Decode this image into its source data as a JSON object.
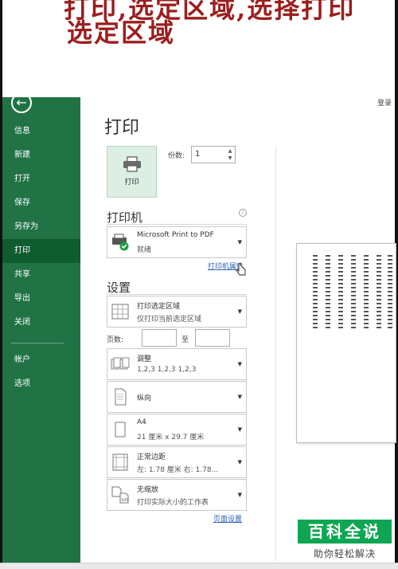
{
  "caption": {
    "line1": "打印,选定区域,选择打印",
    "line2": "选定区域"
  },
  "header": {
    "login": "登录"
  },
  "sidebar": {
    "back": "←",
    "items": [
      {
        "label": "信息"
      },
      {
        "label": "新建"
      },
      {
        "label": "打开"
      },
      {
        "label": "保存"
      },
      {
        "label": "另存为"
      },
      {
        "label": "打印",
        "active": true
      },
      {
        "label": "共享"
      },
      {
        "label": "导出"
      },
      {
        "label": "关闭"
      },
      {
        "label": "帐户"
      },
      {
        "label": "选项"
      }
    ]
  },
  "main": {
    "title": "打印",
    "print_button": "打印",
    "copies_label": "份数:",
    "copies_value": "1",
    "printer_heading": "打印机",
    "printer": {
      "name": "Microsoft Print to PDF",
      "status": "就绪"
    },
    "printer_properties": "打印机属性",
    "settings_heading": "设置",
    "settings": [
      {
        "name": "print-range",
        "t1": "打印选定区域",
        "t2": "仅打印当前选定区域",
        "icon": "sheet-grid-icon"
      },
      {
        "name": "collation",
        "t1": "调整",
        "t2": "1,2,3    1,2,3    1,2,3",
        "icon": "collate-icon"
      },
      {
        "name": "orientation",
        "t1": "纵向",
        "t2": "",
        "icon": "portrait-page-icon"
      },
      {
        "name": "paper-size",
        "t1": "A4",
        "t2": "21 厘米 x 29.7 厘米",
        "icon": "paper-icon"
      },
      {
        "name": "margins",
        "t1": "正常边距",
        "t2": "左: 1.78 厘米    右: 1.78...",
        "icon": "margins-icon"
      },
      {
        "name": "scaling",
        "t1": "无缩放",
        "t2": "打印实际大小的工作表",
        "icon": "no-scaling-icon"
      }
    ],
    "pages_label": "页数:",
    "to_label": "至",
    "page_setup": "页面设置"
  },
  "watermark": {
    "brand": "百科全说",
    "slogan": "助你轻松解决"
  },
  "colors": {
    "accent": "#217346",
    "caption": "#9b1e1e",
    "watermark": "#0fa653"
  }
}
